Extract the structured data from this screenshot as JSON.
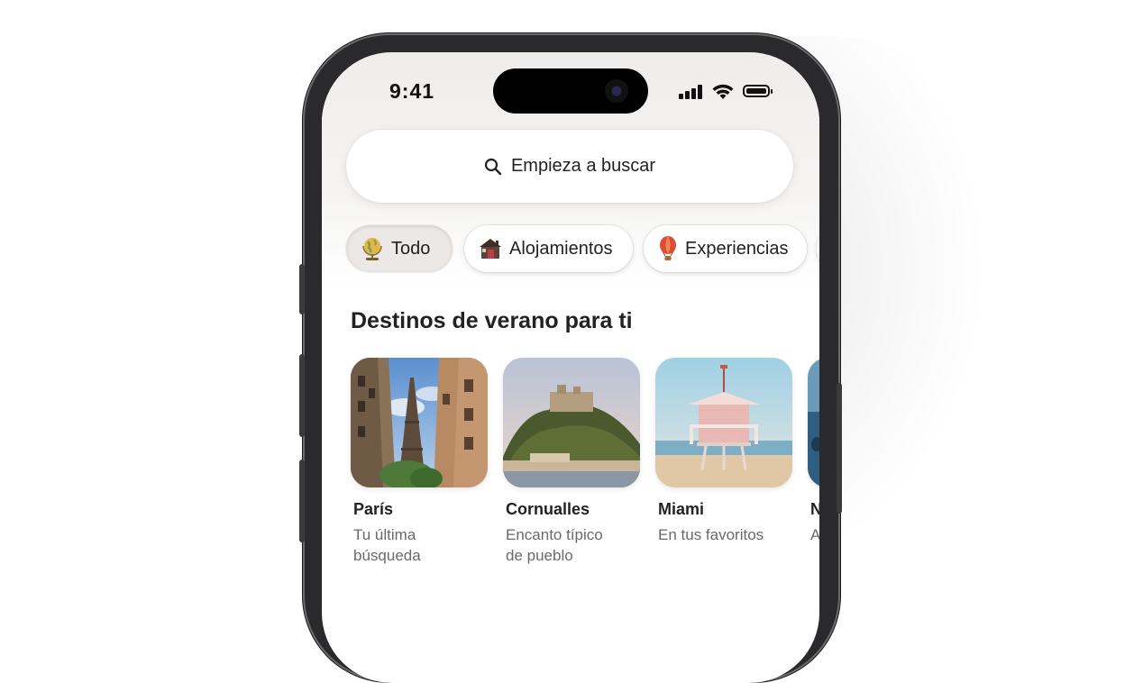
{
  "status_bar": {
    "time": "9:41",
    "icons": [
      "cellular-signal-icon",
      "wifi-icon",
      "battery-icon"
    ]
  },
  "search": {
    "placeholder": "Empieza a buscar",
    "icon": "search-icon"
  },
  "categories": [
    {
      "label": "Todo",
      "icon": "globe-icon",
      "selected": true
    },
    {
      "label": "Alojamientos",
      "icon": "house-icon",
      "selected": false
    },
    {
      "label": "Experiencias",
      "icon": "hot-air-balloon-icon",
      "selected": false
    }
  ],
  "section": {
    "title": "Destinos de verano para ti"
  },
  "destinations": [
    {
      "name": "París",
      "subtitle": "Tu última búsqueda"
    },
    {
      "name": "Cornualles",
      "subtitle": "Encanto típico de pueblo"
    },
    {
      "name": "Miami",
      "subtitle": "En tus favoritos"
    },
    {
      "name": "N",
      "subtitle": "A"
    }
  ],
  "colors": {
    "text_primary": "#222222",
    "text_secondary": "#6a6a6a",
    "chip_selected_bg": "#ebe8e6"
  }
}
